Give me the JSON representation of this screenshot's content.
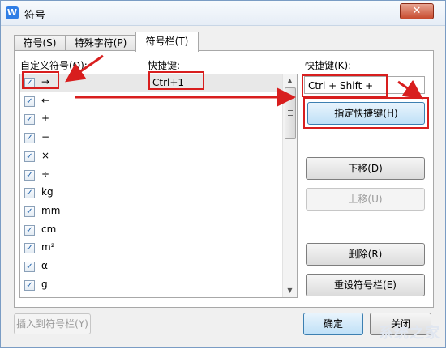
{
  "window": {
    "title": "符号",
    "close_glyph": "✕",
    "app_icon": "W"
  },
  "tabs": [
    {
      "label": "符号(S)",
      "active": false
    },
    {
      "label": "特殊字符(P)",
      "active": false
    },
    {
      "label": "符号栏(T)",
      "active": true
    }
  ],
  "list": {
    "header_symbol": "自定义符号(O):",
    "header_hotkey": "快捷键:",
    "rows": [
      {
        "checked": true,
        "symbol": "→",
        "hotkey": "Ctrl+1"
      },
      {
        "checked": true,
        "symbol": "←",
        "hotkey": ""
      },
      {
        "checked": true,
        "symbol": "+",
        "hotkey": ""
      },
      {
        "checked": true,
        "symbol": "−",
        "hotkey": ""
      },
      {
        "checked": true,
        "symbol": "×",
        "hotkey": ""
      },
      {
        "checked": true,
        "symbol": "÷",
        "hotkey": ""
      },
      {
        "checked": true,
        "symbol": "kg",
        "hotkey": ""
      },
      {
        "checked": true,
        "symbol": "mm",
        "hotkey": ""
      },
      {
        "checked": true,
        "symbol": "cm",
        "hotkey": ""
      },
      {
        "checked": true,
        "symbol": "m²",
        "hotkey": ""
      },
      {
        "checked": true,
        "symbol": "α",
        "hotkey": ""
      },
      {
        "checked": true,
        "symbol": "g",
        "hotkey": ""
      }
    ]
  },
  "hotkey_panel": {
    "label": "快捷键(K):",
    "input_value": "Ctrl + Shift + ",
    "assign_button": "指定快捷键(H)",
    "move_down_button": "下移(D)",
    "move_up_button": "上移(U)",
    "delete_button": "删除(R)",
    "reset_button": "重设符号栏(E)"
  },
  "footer": {
    "insert_button": "插入到符号栏(Y)",
    "ok_button": "确定",
    "cancel_button": "关闭"
  },
  "colors": {
    "annotation_red": "#d81e1e",
    "window_border": "#7a9cc4"
  },
  "icons": {
    "checkbox_check": "✓",
    "scroll_up": "▲",
    "scroll_down": "▼"
  }
}
